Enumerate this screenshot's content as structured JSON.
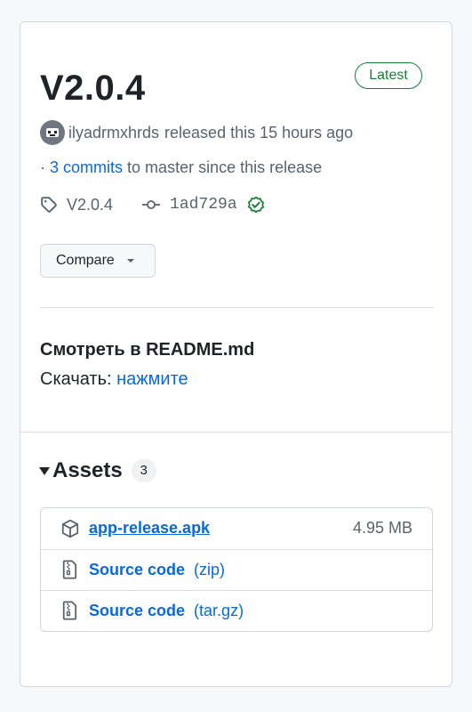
{
  "release": {
    "title": "V2.0.4",
    "badge": "Latest",
    "author": "ilyadrmxhrds",
    "released_text": "released this 15 hours ago",
    "commits_prefix": "·",
    "commits_link": "3 commits",
    "commits_suffix": "to master since this release",
    "tag": "V2.0.4",
    "commit_sha": "1ad729a",
    "compare_label": "Compare"
  },
  "body": {
    "readme_heading": "Смотреть в README.md",
    "download_label": "Скачать:",
    "download_link": "нажмите"
  },
  "assets": {
    "title": "Assets",
    "count": "3",
    "items": [
      {
        "name": "app-release.apk",
        "ext": "",
        "size": "4.95 MB",
        "icon": "package-icon"
      },
      {
        "name": "Source code",
        "ext": "(zip)",
        "size": "",
        "icon": "file-zip-icon"
      },
      {
        "name": "Source code",
        "ext": "(tar.gz)",
        "size": "",
        "icon": "file-zip-icon"
      }
    ]
  },
  "colors": {
    "accent": "#0969da",
    "success": "#1a7f37",
    "muted": "#59636e",
    "border": "#d0d7de"
  }
}
